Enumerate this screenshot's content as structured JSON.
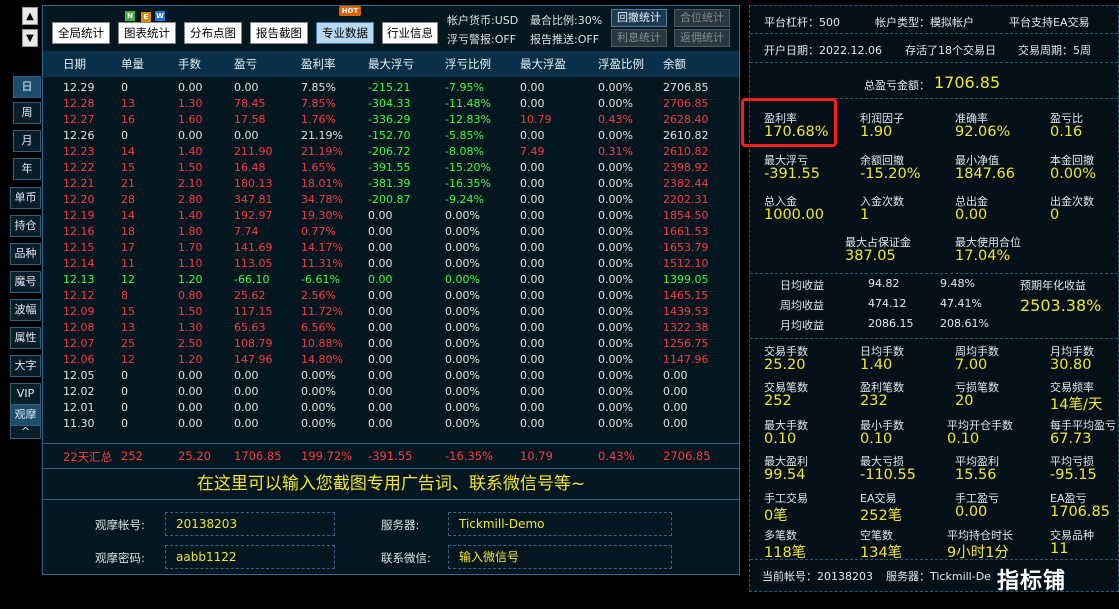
{
  "left": {
    "buttons": [
      "日",
      "周",
      "月",
      "年",
      "单币",
      "持仓",
      "品种",
      "魔号",
      "波幅",
      "属性",
      "大字",
      "VIP",
      "观摩",
      "^"
    ]
  },
  "toolbar": {
    "btn_global": "全局统计",
    "btn_chart": "图表统计",
    "btn_distribution": "分布点图",
    "btn_report": "报告截图",
    "btn_pro": "专业数据",
    "btn_industry": "行业信息",
    "new_badge": [
      "N",
      "E",
      "W"
    ],
    "hot_badge": "HOT",
    "currency": "帐户货币:USD",
    "max_position": "最合比例:30%",
    "float_warn": "浮亏警报:OFF",
    "report_push": "报告推送:OFF",
    "btn_withdraw_stats": "回撤统计",
    "btn_position_stats": "合位统计",
    "btn_interest_stats": "利息统计",
    "btn_return_stats": "返佣统计"
  },
  "table": {
    "headers": [
      "日期",
      "单量",
      "手数",
      "盈亏",
      "盈利率",
      "最大浮亏",
      "浮亏比例",
      "最大浮盈",
      "浮盈比例",
      "余额"
    ],
    "rows": [
      {
        "c": "white",
        "cells": [
          "12.29",
          "0",
          "0.00",
          "0.00",
          "7.85%",
          "-215.21",
          "-7.95%",
          "0.00",
          "0.00%",
          "2706.85"
        ]
      },
      {
        "c": "red",
        "cells": [
          "12.28",
          "13",
          "1.30",
          "78.45",
          "7.85%",
          "-304.33",
          "-11.48%",
          "0.00",
          "0.00%",
          "2706.85"
        ]
      },
      {
        "c": "red",
        "cells": [
          "12.27",
          "16",
          "1.60",
          "17.58",
          "1.76%",
          "-336.29",
          "-12.83%",
          "10.79",
          "0.43%",
          "2628.40"
        ]
      },
      {
        "c": "white",
        "cells": [
          "12.26",
          "0",
          "0.00",
          "0.00",
          "21.19%",
          "-152.70",
          "-5.85%",
          "0.00",
          "0.00%",
          "2610.82"
        ]
      },
      {
        "c": "red",
        "cells": [
          "12.23",
          "14",
          "1.40",
          "211.90",
          "21.19%",
          "-206.72",
          "-8.08%",
          "7.49",
          "0.31%",
          "2610.82"
        ]
      },
      {
        "c": "red",
        "cells": [
          "12.22",
          "15",
          "1.50",
          "16.48",
          "1.65%",
          "-391.55",
          "-15.20%",
          "0.00",
          "0.00%",
          "2398.92"
        ]
      },
      {
        "c": "red",
        "cells": [
          "12.21",
          "21",
          "2.10",
          "180.13",
          "18.01%",
          "-381.39",
          "-16.35%",
          "0.00",
          "0.00%",
          "2382.44"
        ]
      },
      {
        "c": "red",
        "cells": [
          "12.20",
          "28",
          "2.80",
          "347.81",
          "34.78%",
          "-200.87",
          "-9.24%",
          "0.00",
          "0.00%",
          "2202.31"
        ]
      },
      {
        "c": "red",
        "cells": [
          "12.19",
          "14",
          "1.40",
          "192.97",
          "19.30%",
          "0.00",
          "0.00%",
          "0.00",
          "0.00%",
          "1854.50"
        ]
      },
      {
        "c": "red",
        "cells": [
          "12.16",
          "18",
          "1.80",
          "7.74",
          "0.77%",
          "0.00",
          "0.00%",
          "0.00",
          "0.00%",
          "1661.53"
        ]
      },
      {
        "c": "red",
        "cells": [
          "12.15",
          "17",
          "1.70",
          "141.69",
          "14.17%",
          "0.00",
          "0.00%",
          "0.00",
          "0.00%",
          "1653.79"
        ]
      },
      {
        "c": "red",
        "cells": [
          "12.14",
          "11",
          "1.10",
          "113.05",
          "11.31%",
          "0.00",
          "0.00%",
          "0.00",
          "0.00%",
          "1512.10"
        ]
      },
      {
        "c": "green",
        "cells": [
          "12.13",
          "12",
          "1.20",
          "-66.10",
          "-6.61%",
          "0.00",
          "0.00%",
          "0.00",
          "0.00%",
          "1399.05"
        ]
      },
      {
        "c": "red",
        "cells": [
          "12.12",
          "8",
          "0.80",
          "25.62",
          "2.56%",
          "0.00",
          "0.00%",
          "0.00",
          "0.00%",
          "1465.15"
        ]
      },
      {
        "c": "red",
        "cells": [
          "12.09",
          "15",
          "1.50",
          "117.15",
          "11.72%",
          "0.00",
          "0.00%",
          "0.00",
          "0.00%",
          "1439.53"
        ]
      },
      {
        "c": "red",
        "cells": [
          "12.08",
          "13",
          "1.30",
          "65.63",
          "6.56%",
          "0.00",
          "0.00%",
          "0.00",
          "0.00%",
          "1322.38"
        ]
      },
      {
        "c": "red",
        "cells": [
          "12.07",
          "25",
          "2.50",
          "108.79",
          "10.88%",
          "0.00",
          "0.00%",
          "0.00",
          "0.00%",
          "1256.75"
        ]
      },
      {
        "c": "red",
        "cells": [
          "12.06",
          "12",
          "1.20",
          "147.96",
          "14.80%",
          "0.00",
          "0.00%",
          "0.00",
          "0.00%",
          "1147.96"
        ]
      },
      {
        "c": "white",
        "cells": [
          "12.05",
          "0",
          "0.00",
          "0.00",
          "0.00%",
          "0.00",
          "0.00%",
          "0.00",
          "0.00%",
          "0.00"
        ]
      },
      {
        "c": "white",
        "cells": [
          "12.02",
          "0",
          "0.00",
          "0.00",
          "0.00%",
          "0.00",
          "0.00%",
          "0.00",
          "0.00%",
          "0.00"
        ]
      },
      {
        "c": "white",
        "cells": [
          "12.01",
          "0",
          "0.00",
          "0.00",
          "0.00%",
          "0.00",
          "0.00%",
          "0.00",
          "0.00%",
          "0.00"
        ]
      },
      {
        "c": "white",
        "cells": [
          "11.30",
          "0",
          "0.00",
          "0.00",
          "0.00%",
          "0.00",
          "0.00%",
          "0.00",
          "0.00%",
          "0.00"
        ]
      }
    ],
    "summary": [
      "22天汇总",
      "252",
      "25.20",
      "1706.85",
      "199.72%",
      "-391.55",
      "-16.35%",
      "10.79",
      "0.43%",
      "2706.85"
    ]
  },
  "ad_text": "在这里可以输入您截图专用广告词、联系微信号等~",
  "account": {
    "watch_id_label": "观摩帐号:",
    "watch_id": "20138203",
    "server_label": "服务器:",
    "server": "Tickmill-Demo",
    "watch_pwd_label": "观摩密码:",
    "watch_pwd": "aabb1122",
    "wechat_label": "联系微信:",
    "wechat": "输入微信号"
  },
  "right": {
    "leverage": "平台杠杆：500",
    "acct_type": "帐户类型：模拟帐户",
    "ea_support": "平台支持EA交易",
    "open_date": "开户日期：2022.12.06",
    "survive": "存活了18个交易日",
    "cycle": "交易周期：5周",
    "total_profit_label": "总盈亏金额：",
    "total_profit": "1706.85",
    "m1": [
      {
        "l": "盈利率",
        "v": "170.68%"
      },
      {
        "l": "利润因子",
        "v": "1.90"
      },
      {
        "l": "准确率",
        "v": "92.06%"
      },
      {
        "l": "盈亏比",
        "v": "0.16"
      }
    ],
    "m2": [
      {
        "l": "最大浮亏",
        "v": "-391.55"
      },
      {
        "l": "余额回撤",
        "v": "-15.20%"
      },
      {
        "l": "最小净值",
        "v": "1847.66"
      },
      {
        "l": "本金回撤",
        "v": "0.00%"
      }
    ],
    "m3": [
      {
        "l": "总入金",
        "v": "1000.00"
      },
      {
        "l": "入金次数",
        "v": "1"
      },
      {
        "l": "总出金",
        "v": "0.00"
      },
      {
        "l": "出金次数",
        "v": "0"
      }
    ],
    "m4": [
      {
        "l": "最大占保证金",
        "v": "387.05"
      },
      {
        "l": "最大使用合位",
        "v": "17.04%"
      }
    ],
    "returns": [
      {
        "l": "日均收益",
        "a": "94.82",
        "p": "9.48%"
      },
      {
        "l": "周均收益",
        "a": "474.12",
        "p": "47.41%"
      },
      {
        "l": "月均收益",
        "a": "2086.15",
        "p": "208.61%"
      }
    ],
    "annual_label": "预期年化收益",
    "annual": "2503.38%",
    "m5": [
      {
        "l": "交易手数",
        "v": "25.20"
      },
      {
        "l": "日均手数",
        "v": "1.40"
      },
      {
        "l": "周均手数",
        "v": "7.00"
      },
      {
        "l": "月均手数",
        "v": "30.80"
      }
    ],
    "m6": [
      {
        "l": "交易笔数",
        "v": "252"
      },
      {
        "l": "盈利笔数",
        "v": "232"
      },
      {
        "l": "亏损笔数",
        "v": "20"
      },
      {
        "l": "交易频率",
        "v": "14笔/天"
      }
    ],
    "m7": [
      {
        "l": "最大手数",
        "v": "0.10"
      },
      {
        "l": "最小手数",
        "v": "0.10"
      },
      {
        "l": "平均开仓手数",
        "v": "0.10"
      },
      {
        "l": "每手平均盈亏",
        "v": "67.73"
      }
    ],
    "m8": [
      {
        "l": "最大盈利",
        "v": "99.54"
      },
      {
        "l": "最大亏损",
        "v": "-110.55"
      },
      {
        "l": "平均盈利",
        "v": "15.56"
      },
      {
        "l": "平均亏损",
        "v": "-95.15"
      }
    ],
    "m9": [
      {
        "l": "手工交易",
        "v": "0笔"
      },
      {
        "l": "EA交易",
        "v": "252笔"
      },
      {
        "l": "手工盈亏",
        "v": "0.00"
      },
      {
        "l": "EA盈亏",
        "v": "1706.85"
      }
    ],
    "m10": [
      {
        "l": "多笔数",
        "v": "118笔"
      },
      {
        "l": "空笔数",
        "v": "134笔"
      },
      {
        "l": "平均持仓时长",
        "v": "9小时1分"
      },
      {
        "l": "交易品种",
        "v": "11"
      }
    ],
    "current_acct": "当前帐号：20138203",
    "current_server": "服务器：Tickmill-De"
  },
  "watermark": "指标铺"
}
